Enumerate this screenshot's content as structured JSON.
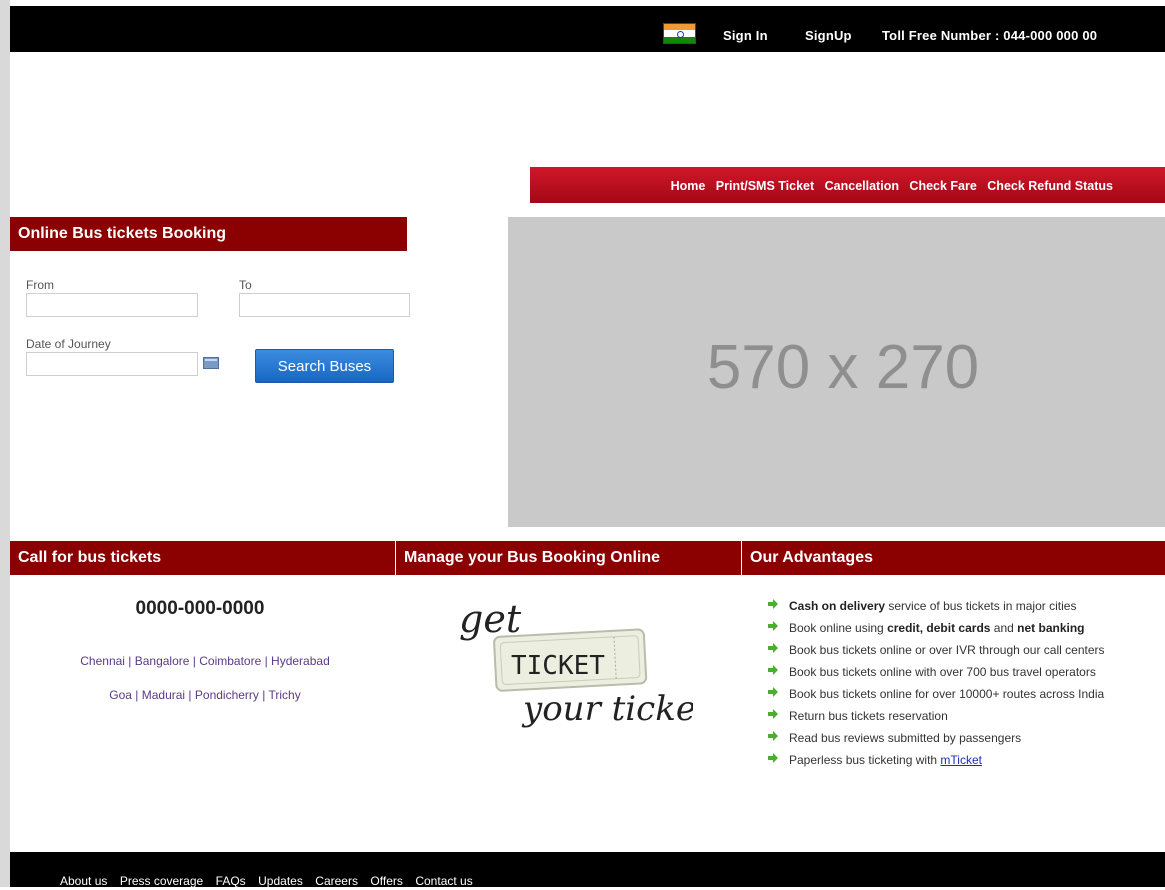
{
  "topbar": {
    "sign_in": "Sign In",
    "sign_up": "SignUp",
    "toll_free": "Toll Free Number : 044-000 000 00"
  },
  "nav": {
    "items": [
      "Home",
      "Print/SMS Ticket",
      "Cancellation",
      "Check Fare",
      "Check Refund Status"
    ]
  },
  "booking": {
    "title": "Online Bus tickets Booking",
    "from_label": "From",
    "to_label": "To",
    "date_label": "Date of Journey",
    "from_value": "",
    "to_value": "",
    "date_value": "",
    "search_button": "Search Buses"
  },
  "banner": {
    "text": "570 x 270"
  },
  "call": {
    "title": "Call for bus tickets",
    "phone": "0000-000-0000",
    "cities_line1": "Chennai | Bangalore | Coimbatore | Hyderabad",
    "cities_line2": "Goa | Madurai | Pondicherry | Trichy"
  },
  "manage": {
    "title": "Manage your Bus Booking Online",
    "logo_get": "get",
    "logo_ticket": "TICKET",
    "logo_your": "your ticket"
  },
  "advantages": {
    "title": "Our Advantages",
    "items": [
      {
        "bold": "Cash on delivery",
        "text": " service of bus tickets in major cities"
      },
      {
        "pre": "Book online using ",
        "bold1": "credit, debit cards",
        "mid": " and ",
        "bold2": "net banking"
      },
      {
        "text": "Book bus tickets online or over IVR through our call centers"
      },
      {
        "text": "Book bus tickets online with over 700 bus travel operators"
      },
      {
        "text": "Book bus tickets online for over 10000+ routes across India"
      },
      {
        "text": "Return bus tickets reservation"
      },
      {
        "text": "Read bus reviews submitted by passengers"
      },
      {
        "pre": "Paperless bus ticketing with ",
        "link": "mTicket"
      }
    ]
  },
  "footer": {
    "items": [
      "About us",
      "Press coverage",
      "FAQs",
      "Updates",
      "Careers",
      "Offers",
      "Contact us"
    ]
  },
  "colors": {
    "accent_red": "#8b0000",
    "nav_red": "#c1121f",
    "button_blue": "#1f74d2",
    "top_bar": "#000000"
  }
}
